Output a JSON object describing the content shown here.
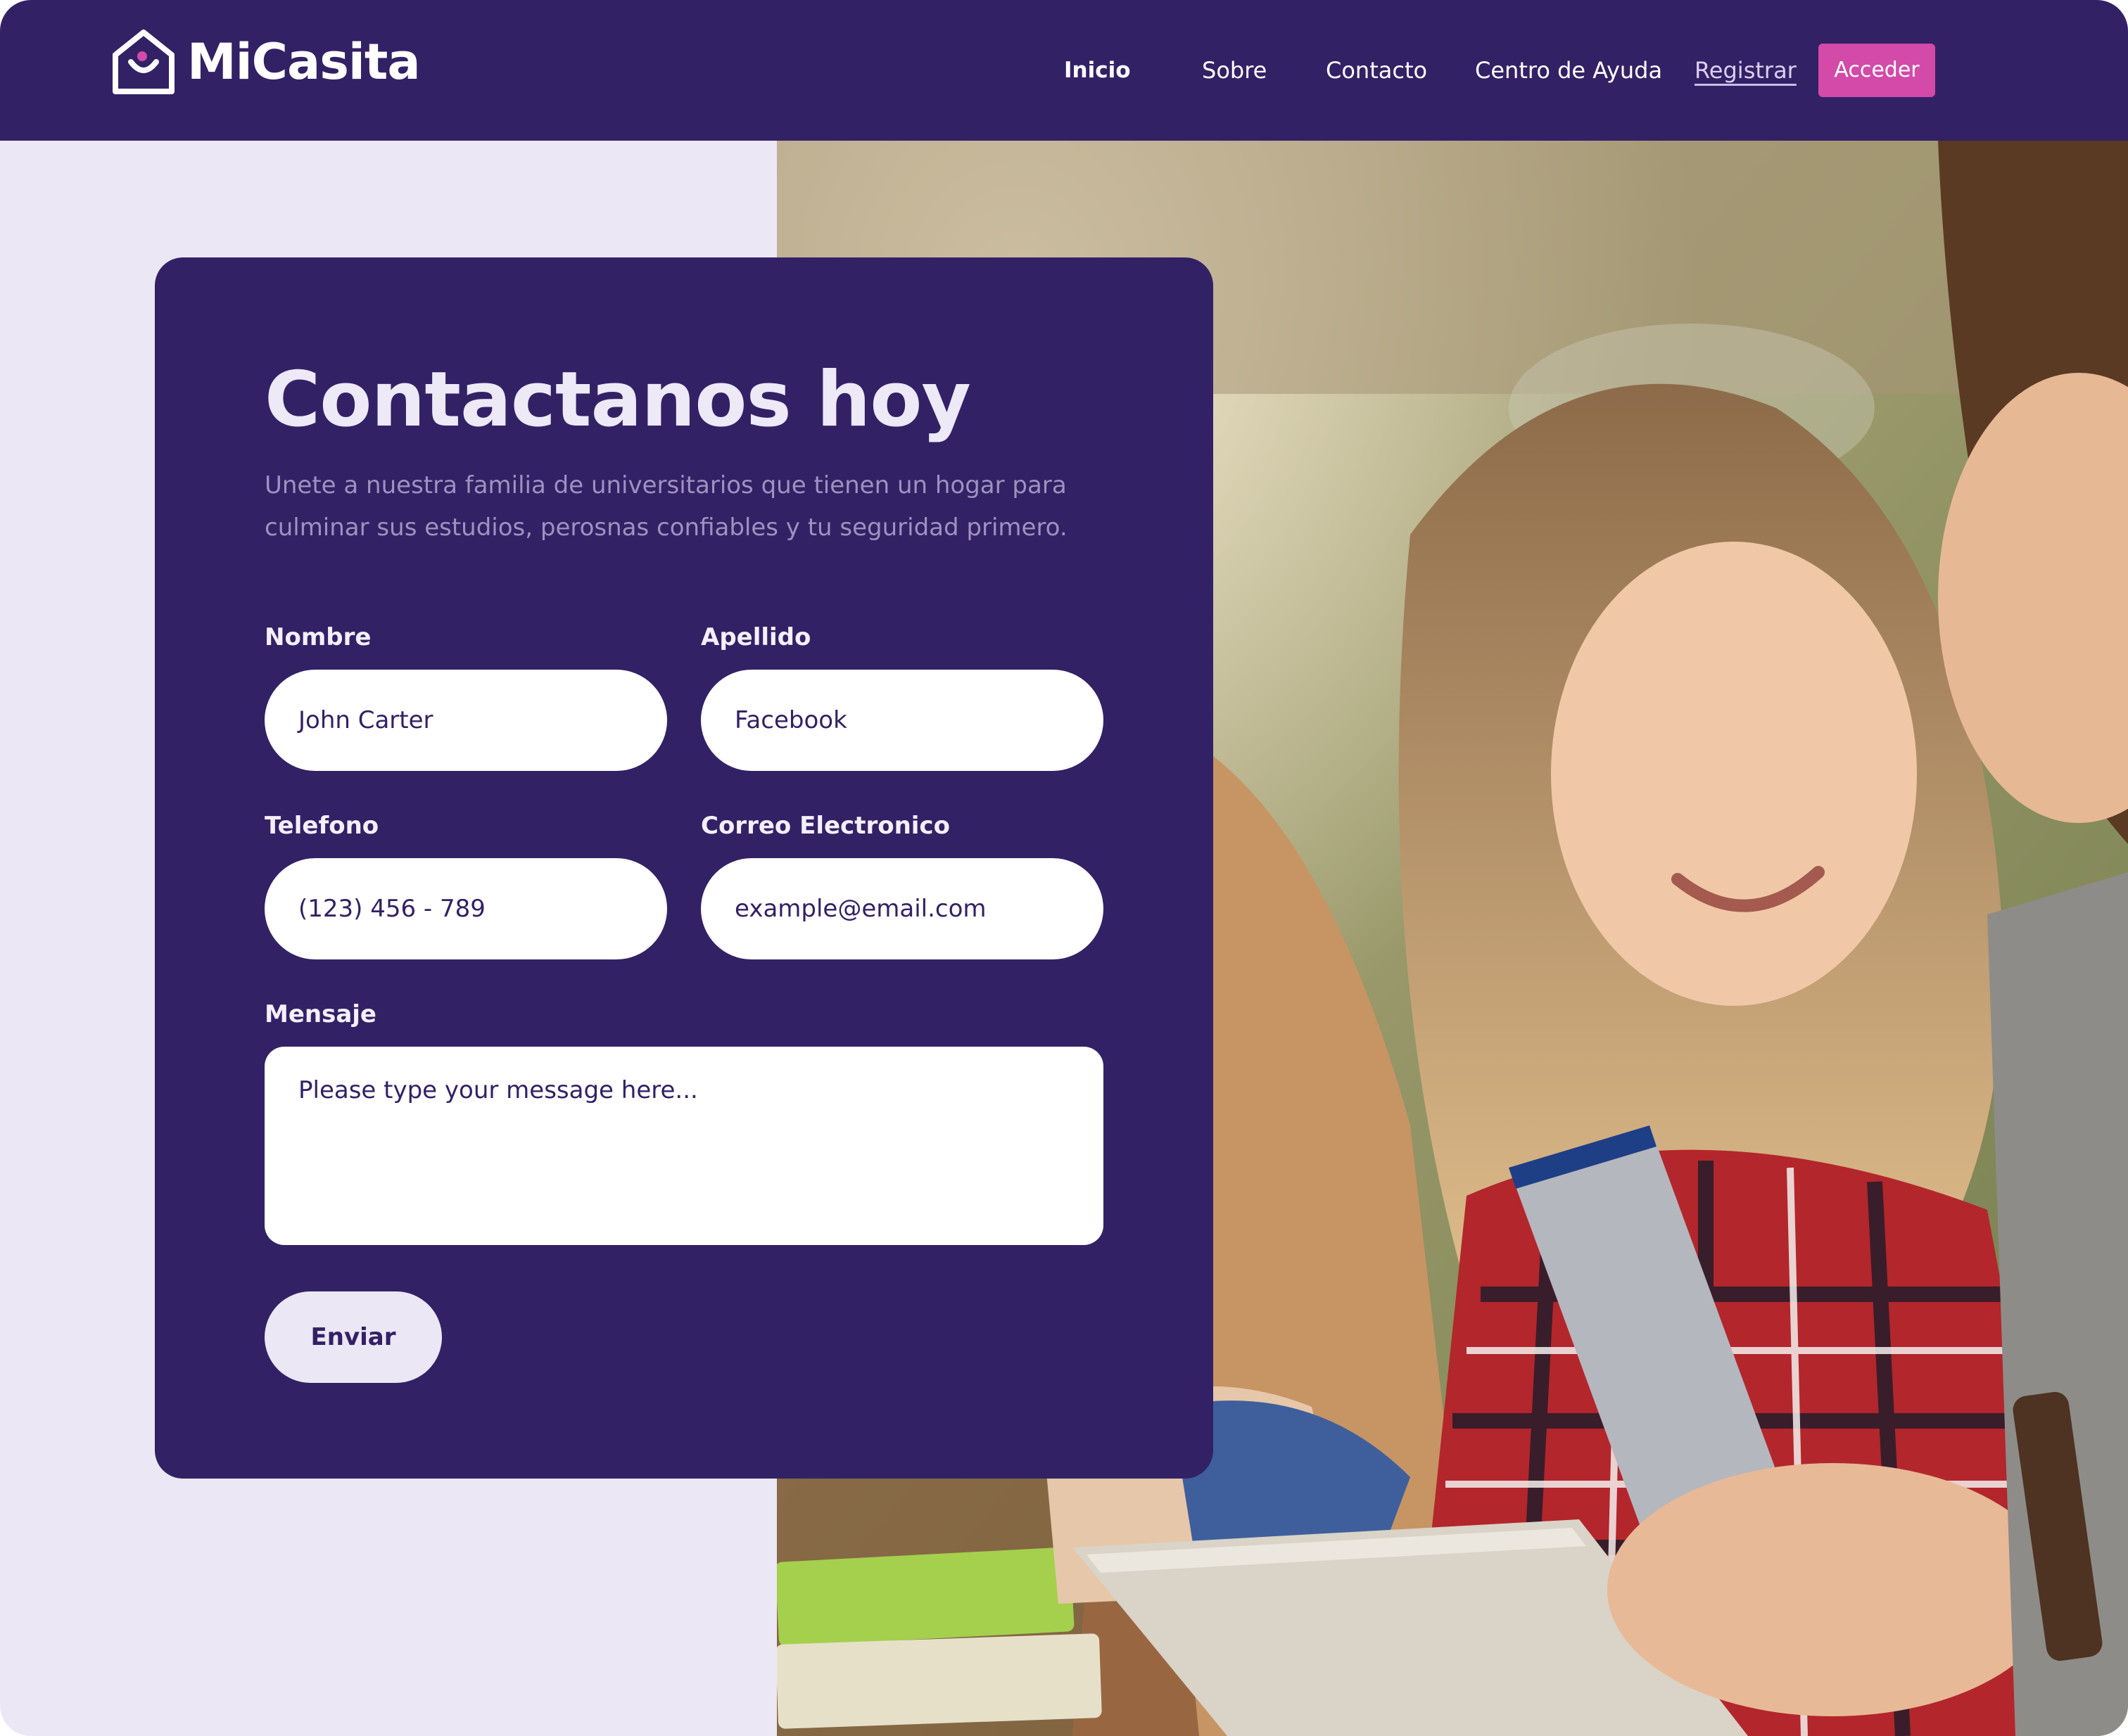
{
  "header": {
    "logo_text": "MiCasita",
    "nav": [
      {
        "label": "Inicio"
      },
      {
        "label": "Sobre"
      },
      {
        "label": "Contacto"
      },
      {
        "label": "Centro de Ayuda"
      },
      {
        "label": "Registrar"
      }
    ],
    "cta_label": "Acceder"
  },
  "contact": {
    "title": "Contactanos hoy",
    "subtitle": "Unete  a nuestra familia de universitarios que tienen un hogar para culminar sus estudios, perosnas confiables y tu seguridad primero.",
    "fields": {
      "nombre": {
        "label": "Nombre",
        "value": "John Carter"
      },
      "apellido": {
        "label": "Apellido",
        "value": "Facebook"
      },
      "telefono": {
        "label": "Telefono",
        "value": "(123) 456 - 789"
      },
      "correo": {
        "label": "Correo Electronico",
        "value": "example@email.com"
      },
      "mensaje": {
        "label": "Mensaje",
        "placeholder": "Please type your message here..."
      }
    },
    "submit_label": "Enviar"
  },
  "colors": {
    "primary": "#332166",
    "page_bg": "#ebe7f4",
    "accent": "#d34aa8",
    "text_light": "#ede9f7",
    "subtitle": "#9c93bf"
  },
  "icons": {
    "logo": "house-smile-icon"
  }
}
